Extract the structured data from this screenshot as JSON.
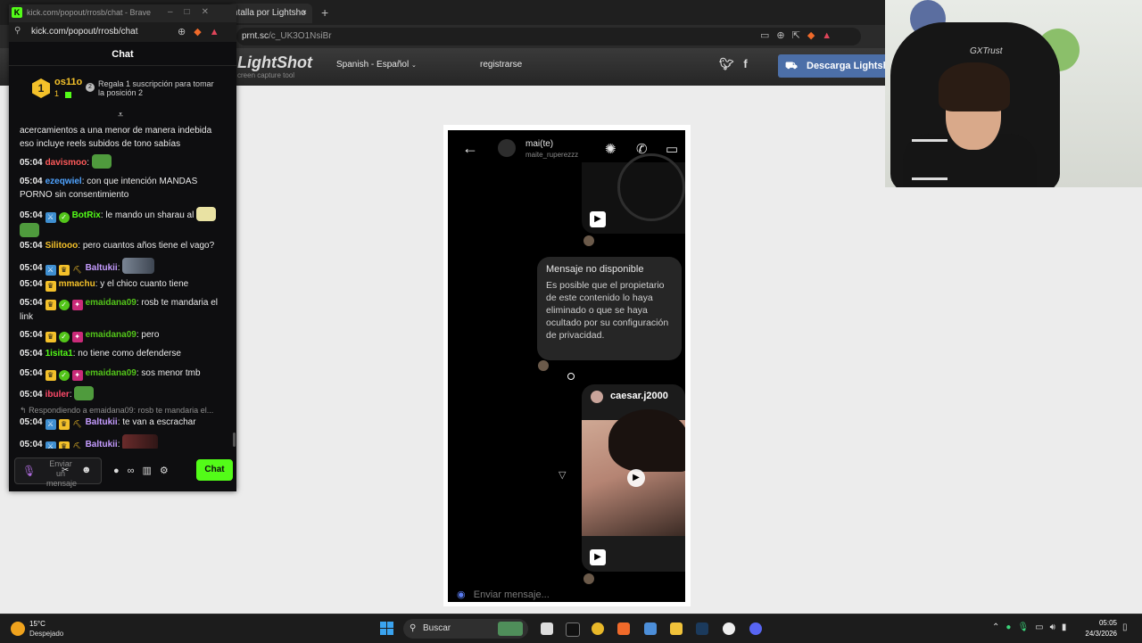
{
  "bg_browser": {
    "tab_title": "ntalla por Lightsho",
    "tab_close": "×",
    "new_tab": "+",
    "address_host": "prnt.sc",
    "address_path": "/c_UK3O1NsiBr"
  },
  "lightshot": {
    "logo": "LightShot",
    "logo_sub": "creen capture tool",
    "language": "Spanish - Español",
    "register": "registrarse",
    "download": "Descarga Lightsho"
  },
  "phone": {
    "contact_name": "mai(te)",
    "contact_user": "maite_ruperezzz",
    "unavailable_title": "Mensaje no disponible",
    "unavailable_body": "Es posible que el propietario de este contenido lo haya eliminado o que se haya ocultado por su configuración de privacidad.",
    "video_author": "caesar.j2000",
    "compose_placeholder": "Enviar mensaje..."
  },
  "cam": {
    "chair_brand": "GXTrust"
  },
  "kick": {
    "window_title": "kick.com/popout/rrosb/chat - Brave",
    "address": "kick.com/popout/rrosb/chat",
    "header_title": "Chat",
    "pinned": {
      "rank": "1",
      "username": "os11o",
      "count": "1",
      "promo_text": "Regala 1 suscripción para tomar la posición 2"
    },
    "messages": [
      {
        "time": "",
        "user": "",
        "text": "acercamientos a una menor de manera indebida eso incluye reels subidos de tono sabías"
      },
      {
        "time": "05:04",
        "user": "davismoo",
        "text": ""
      },
      {
        "time": "05:04",
        "user": "ezeqwiel",
        "text": "con que intención MANDAS PORNO sin consentimiento"
      },
      {
        "time": "05:04",
        "user": "BotRix",
        "text": "le mando un sharau al"
      },
      {
        "time": "05:04",
        "user": "Silitooo",
        "text": "pero cuantos años tiene el vago?"
      },
      {
        "time": "05:04",
        "user": "Baltukii",
        "text": ""
      },
      {
        "time": "05:04",
        "user": "mmachu",
        "text": "y el chico cuanto tiene"
      },
      {
        "time": "05:04",
        "user": "emaidana09",
        "text": "rosb te mandaria el link"
      },
      {
        "time": "05:04",
        "user": "emaidana09",
        "text": "pero"
      },
      {
        "time": "05:04",
        "user": "1isita1",
        "text": "no tiene como defenderse"
      },
      {
        "time": "05:04",
        "user": "emaidana09",
        "text": "sos menor tmb"
      },
      {
        "time": "05:04",
        "user": "ibuler",
        "text": ""
      },
      {
        "time": "05:04",
        "user": "Baltukii",
        "text": "te van a escrachar"
      },
      {
        "time": "05:04",
        "user": "Baltukii",
        "text": ""
      }
    ],
    "reply_preview": "Respondiendo a emaidana09: rosb te mandaria el...",
    "input_placeholder": "Enviar un mensaje",
    "send_label": "Chat",
    "colors": {
      "accent": "#53fc18",
      "davismoo": "#ff5a5a",
      "ezeqwiel": "#4fa3ff",
      "botrix": "#53fc18",
      "silitooo": "#f4c12a",
      "baltukii": "#c59cff",
      "mmachu": "#f4c12a",
      "emaidana09": "#53c51a",
      "isita": "#53fc18",
      "ibuler": "#ff4a6a"
    }
  },
  "taskbar": {
    "temp": "15°C",
    "weather": "Despejado",
    "search": "Buscar",
    "time": "05:05",
    "date": "24/3/2026"
  }
}
